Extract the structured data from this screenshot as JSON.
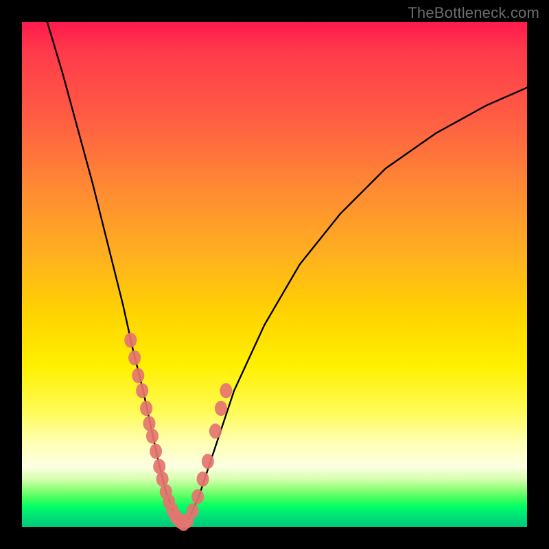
{
  "watermark": "TheBottleneck.com",
  "colors": {
    "frame": "#000000",
    "curve": "#000000",
    "marker": "#e5746f"
  },
  "chart_data": {
    "type": "line",
    "title": "",
    "xlabel": "",
    "ylabel": "",
    "xlim": [
      0,
      100
    ],
    "ylim": [
      0,
      100
    ],
    "grid": false,
    "legend": false,
    "series": [
      {
        "name": "bottleneck-curve",
        "x": [
          5,
          8,
          11,
          14,
          17,
          20,
          22,
          24,
          25.5,
          27,
          28.5,
          30,
          31,
          32,
          33,
          35,
          38,
          42,
          48,
          55,
          63,
          72,
          82,
          92,
          100
        ],
        "y": [
          100,
          90,
          79,
          68,
          56,
          44,
          35,
          27,
          20,
          13,
          7,
          3,
          1,
          0.5,
          1.5,
          6,
          15,
          27,
          40,
          52,
          62,
          71,
          78,
          83.5,
          87
        ]
      }
    ],
    "markers": {
      "name": "highlighted-points",
      "x": [
        21.5,
        22.3,
        23.0,
        23.8,
        24.6,
        25.2,
        25.8,
        26.5,
        27.2,
        27.8,
        28.5,
        29.1,
        29.8,
        30.5,
        31.3,
        32.0,
        32.8,
        33.8,
        34.8,
        35.8,
        36.8,
        38.3,
        39.4,
        40.4
      ],
      "y": [
        37,
        33.5,
        30,
        27,
        23.5,
        20.5,
        18,
        15,
        12,
        9.5,
        7,
        5,
        3.3,
        2,
        1.2,
        0.7,
        1.3,
        3.2,
        6.0,
        9.5,
        13,
        19,
        23.5,
        27
      ]
    }
  }
}
